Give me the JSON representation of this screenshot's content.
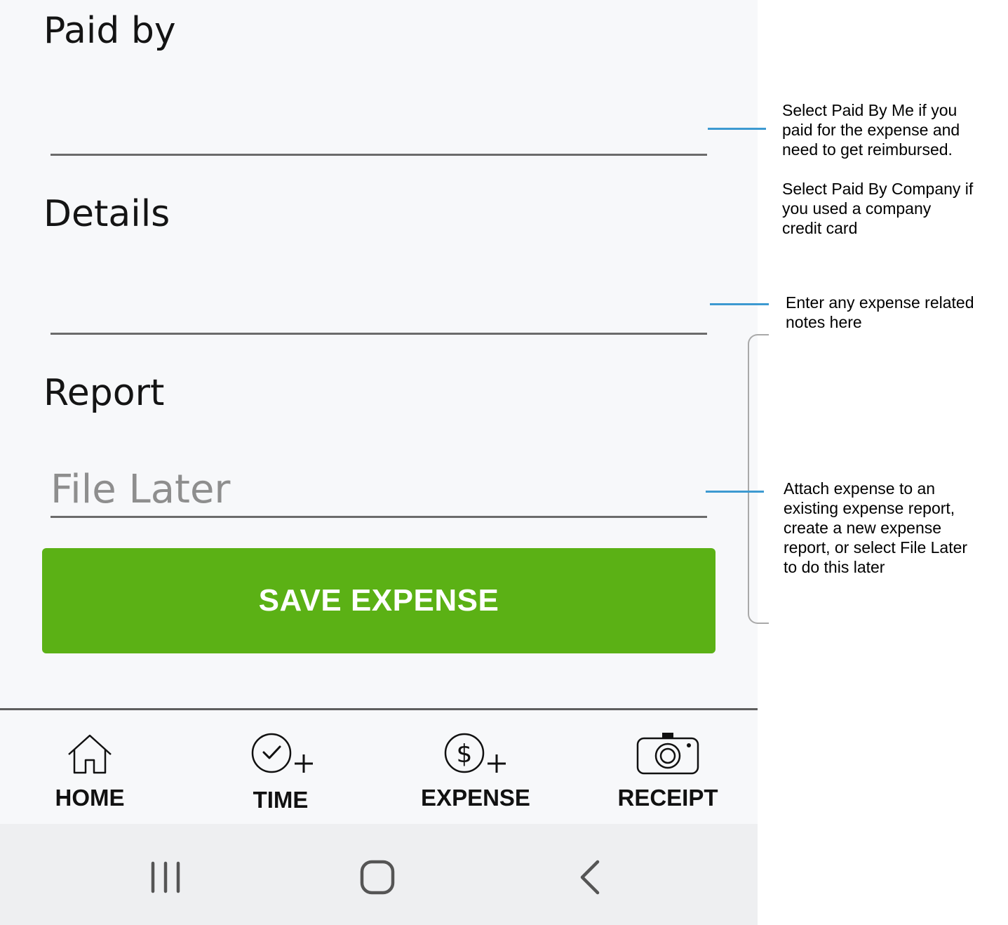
{
  "form": {
    "paid_by": {
      "label": "Paid by",
      "value": "",
      "placeholder": ""
    },
    "details": {
      "label": "Details",
      "value": "",
      "placeholder": ""
    },
    "report": {
      "label": "Report",
      "value": "",
      "placeholder": "File Later"
    }
  },
  "actions": {
    "save_label": "SAVE EXPENSE",
    "save_color": "#5bb115"
  },
  "bottom_nav": {
    "items": [
      {
        "label": "HOME",
        "icon": "home-icon"
      },
      {
        "label": "TIME",
        "icon": "clock-plus-icon"
      },
      {
        "label": "EXPENSE",
        "icon": "dollar-plus-icon"
      },
      {
        "label": "RECEIPT",
        "icon": "camera-icon"
      }
    ]
  },
  "system_nav": {
    "buttons": [
      "recent-apps-icon",
      "home-button-icon",
      "back-icon"
    ]
  },
  "callouts": {
    "paid_by": "Select Paid By Me if you\npaid for the expense and\nneed to get reimbursed.\n\nSelect Paid By Company if\nyou used a company\ncredit card",
    "details": "Enter any expense related\nnotes here",
    "report": "Attach expense to an\nexisting expense report,\ncreate a new expense\nreport, or select File Later\nto do this later",
    "line_color": "#3d9ad1"
  }
}
